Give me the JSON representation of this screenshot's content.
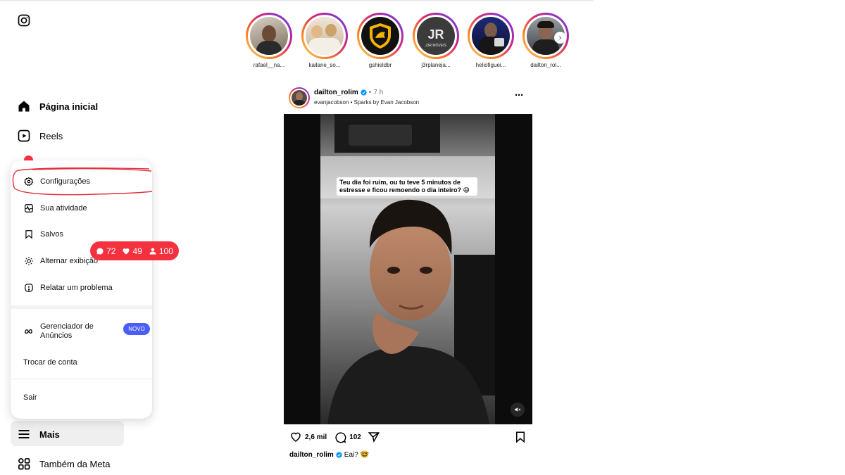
{
  "sidebar": {
    "logo": "instagram-icon",
    "items": [
      {
        "label": "Página inicial",
        "icon": "home-icon"
      },
      {
        "label": "Reels",
        "icon": "reels-icon"
      },
      {
        "label": "Mais",
        "icon": "menu-icon"
      },
      {
        "label": "Também da Meta",
        "icon": "grid-icon"
      }
    ]
  },
  "more_menu": {
    "items": [
      {
        "label": "Configurações",
        "icon": "settings-icon"
      },
      {
        "label": "Sua atividade",
        "icon": "activity-icon"
      },
      {
        "label": "Salvos",
        "icon": "bookmark-icon"
      },
      {
        "label": "Alternar exibição",
        "icon": "sun-icon"
      },
      {
        "label": "Relatar um problema",
        "icon": "report-icon"
      },
      {
        "label": "Gerenciador de Anúncios",
        "icon": "meta-icon",
        "badge": "NOVO"
      },
      {
        "label": "Trocar de conta"
      },
      {
        "label": "Sair"
      }
    ]
  },
  "notification_pill": {
    "comments": "72",
    "likes": "49",
    "followers": "100",
    "color": "#f4323f"
  },
  "stories": [
    {
      "username": "rafael__na..."
    },
    {
      "username": "kailane_so..."
    },
    {
      "username": "gshieldbr"
    },
    {
      "username": "j3rplaneja..."
    },
    {
      "username": "heliofiguei..."
    },
    {
      "username": "dailton_rol..."
    }
  ],
  "post": {
    "username": "dailton_rolim",
    "separator": "•",
    "time": "7 h",
    "audio": "evanjacobson • Sparks by Evan Jacobson",
    "overlay_text": "Teu dia foi ruim, ou tu teve 5 minutos de estresse e ficou remoendo o dia inteiro? 😅",
    "likes": "2,6 mil",
    "comments": "102",
    "caption_user": "dailton_rolim",
    "caption_text": "Eai? 🤓"
  },
  "colors": {
    "accent_blue": "#4a5df9",
    "verified_blue": "#0095f6",
    "notification_red": "#ff3040"
  }
}
